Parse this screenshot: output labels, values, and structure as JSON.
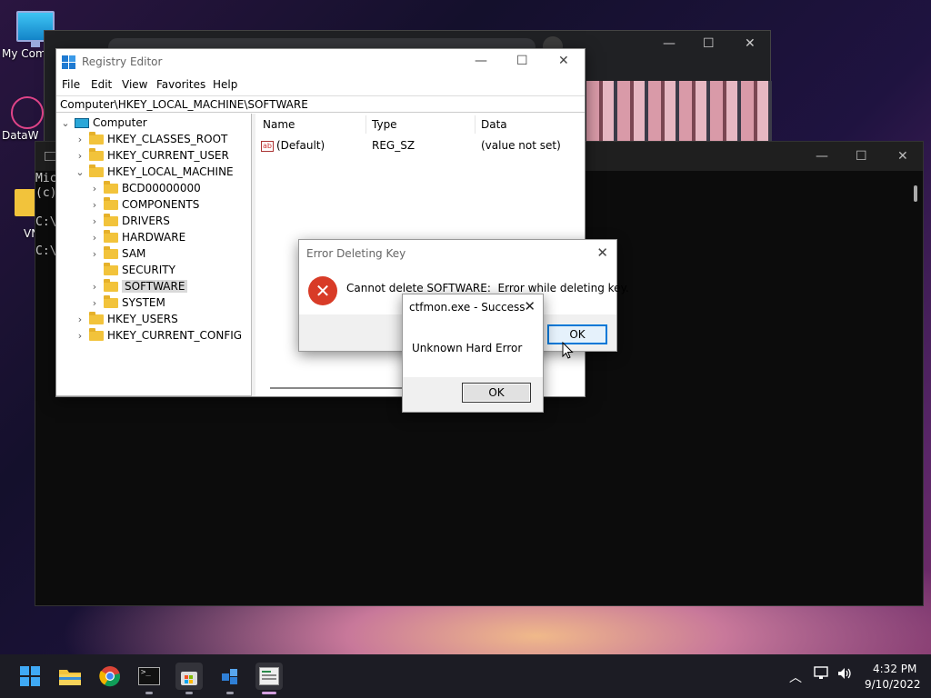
{
  "desktop": {
    "icons": [
      {
        "label": "My Com"
      },
      {
        "label": "DataW"
      },
      {
        "label": "VN"
      }
    ]
  },
  "cmd": {
    "lines": [
      "Mic",
      "(c)",
      "C:\\",
      "C:\\"
    ]
  },
  "regedit": {
    "title": "Registry Editor",
    "menu": [
      "File",
      "Edit",
      "View",
      "Favorites",
      "Help"
    ],
    "address": "Computer\\HKEY_LOCAL_MACHINE\\SOFTWARE",
    "tree": {
      "root": "Computer",
      "hives": [
        "HKEY_CLASSES_ROOT",
        "HKEY_CURRENT_USER",
        "HKEY_LOCAL_MACHINE",
        "HKEY_USERS",
        "HKEY_CURRENT_CONFIG"
      ],
      "hklm_children": [
        "BCD00000000",
        "COMPONENTS",
        "DRIVERS",
        "HARDWARE",
        "SAM",
        "SECURITY",
        "SOFTWARE",
        "SYSTEM"
      ],
      "selected": "SOFTWARE"
    },
    "columns": [
      "Name",
      "Type",
      "Data"
    ],
    "rows": [
      {
        "name": "(Default)",
        "type": "REG_SZ",
        "data": "(value not set)"
      }
    ]
  },
  "error_dialog": {
    "title": "Error Deleting Key",
    "message": "Cannot delete SOFTWARE:  Error while deleting key.",
    "ok_label": "OK"
  },
  "ctfmon_dialog": {
    "title": "ctfmon.exe - Success",
    "message": "Unknown Hard Error",
    "ok_label": "OK"
  },
  "taskbar": {
    "time": "4:32 PM",
    "date": "9/10/2022"
  },
  "colors": {
    "accent": "#0078d7",
    "error": "#d83b27",
    "folder": "#f2c33b"
  }
}
